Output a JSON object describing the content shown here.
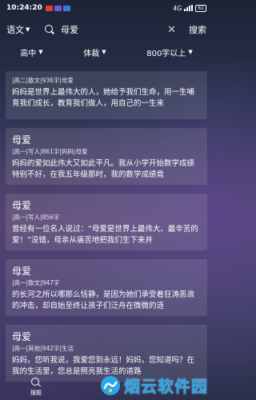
{
  "status_bar": {
    "time": "10:24:20",
    "badge_colors": [
      "#e23b3b",
      "#6e5bd8",
      "#3b7be2"
    ],
    "signal": "4G",
    "battery": "61"
  },
  "top_bar": {
    "language_label": "语文",
    "search_query": "母爱",
    "clear_icon": "close-icon",
    "search_button": "搜索"
  },
  "filters": [
    {
      "label": "高中"
    },
    {
      "label": "体裁"
    },
    {
      "label": "800字以上"
    }
  ],
  "results": [
    {
      "title": "",
      "meta": "|高二|散文|936字|母爱",
      "text": "妈妈是世界上最伟大的人，她给予我们生命，用一生哺育我们成长，教育我们做人，用自己的一生来"
    },
    {
      "title": "母爱",
      "meta": "|高一|写人|861字|妈妈|母爱",
      "text": "妈妈的爱如此伟大又如此平凡。我从小学开始数学成绩特别不好，在我五年级那时，我的数学成绩竟"
    },
    {
      "title": "母爱",
      "meta": "|高一|写人|856字",
      "text": "曾经有一位名人说过：“母爱是世界上最伟大、最辛苦的爱！”没错，母亲从痛苦地把我们生下来并"
    },
    {
      "title": "母爱",
      "meta": "|高一|散文|947字",
      "text": "的长河之所以哪那么恬静，是因为她们承受着狂涛恶浪的冲击，却自始至终让孩子们泛舟在微微的涟"
    },
    {
      "title": "母爱",
      "meta": "|高一|其他|942字|生活",
      "text": "妈妈，您听我说，我爱您到永远！妈妈，您知道吗？在我的生活里，您总是照亮我生活的道路"
    }
  ],
  "bottom_nav": {
    "label": "搜题"
  },
  "watermark": {
    "text": "烟云软件园"
  }
}
